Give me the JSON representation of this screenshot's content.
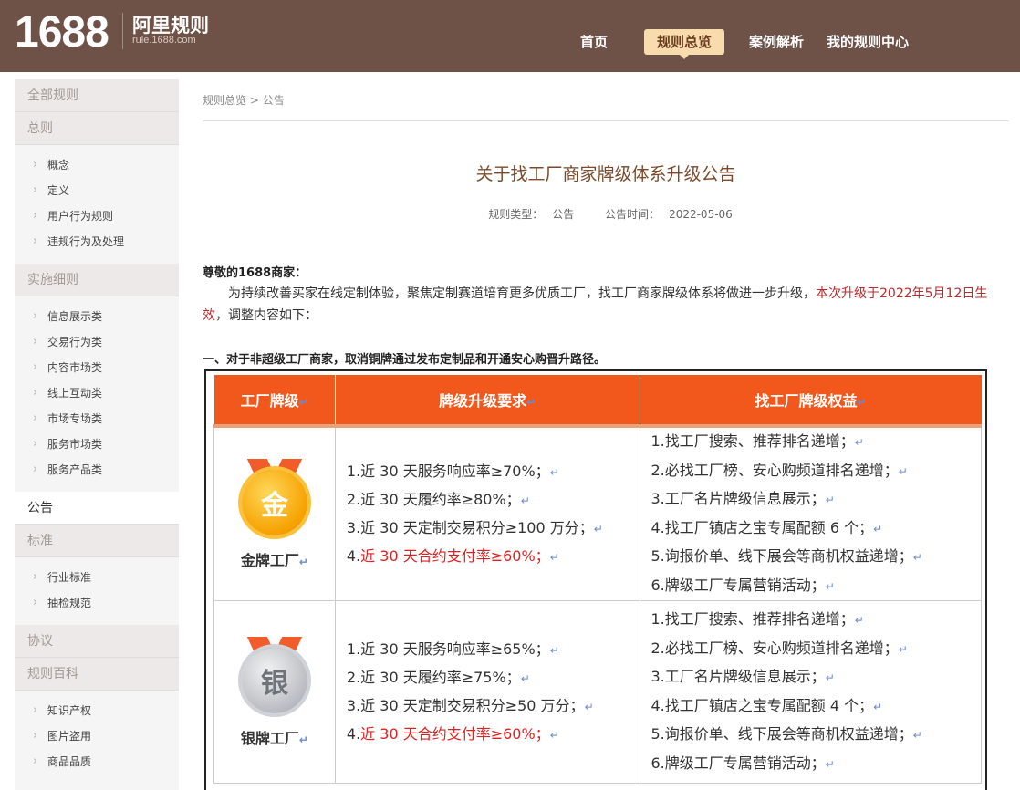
{
  "header": {
    "logo_number": "1688",
    "logo_text": "阿里规则",
    "logo_url": "rule.1688.com",
    "nav": [
      {
        "label": "首页",
        "active": false
      },
      {
        "label": "规则总览",
        "active": true
      },
      {
        "label": "案例解析",
        "active": false
      },
      {
        "label": "我的规则中心",
        "active": false
      }
    ]
  },
  "sidebar": {
    "all": "全部规则",
    "general": {
      "title": "总则",
      "items": [
        "概念",
        "定义",
        "用户行为规则",
        "违规行为及处理"
      ]
    },
    "detail": {
      "title": "实施细则",
      "items": [
        "信息展示类",
        "交易行为类",
        "内容市场类",
        "线上互动类",
        "市场专场类",
        "服务市场类",
        "服务产品类"
      ]
    },
    "notice": "公告",
    "standard": {
      "title": "标准",
      "items": [
        "行业标准",
        "抽检规范"
      ]
    },
    "agreement": "协议",
    "wiki": {
      "title": "规则百科",
      "items": [
        "知识产权",
        "图片盗用",
        "商品品质"
      ]
    }
  },
  "breadcrumb": {
    "root": "规则总览",
    "sep": ">",
    "current": "公告"
  },
  "article": {
    "title": "关于找工厂商家牌级体系升级公告",
    "type_label": "规则类型：",
    "type_value": "公告",
    "time_label": "公告时间：",
    "time_value": "2022-05-06",
    "greeting": "尊敬的1688商家：",
    "para_main": "为持续改善买家在线定制体验，聚焦定制赛道培育更多优质工厂，找工厂商家牌级体系将做进一步升级，",
    "para_red": "本次升级于2022年5月12日生效",
    "para_tail": "，调整内容如下：",
    "section1": "一、对于非超级工厂商家，取消铜牌通过发布定制品和开通安心购晋升路径。"
  },
  "table": {
    "headers": [
      "工厂牌级",
      "牌级升级要求",
      "找工厂牌级权益"
    ],
    "mark": "↵",
    "rows": [
      {
        "badge_char": "金",
        "badge_label": "金牌工厂",
        "req": [
          "1.近 30 天服务响应率≥70%；",
          "2.近 30 天履约率≥80%；",
          "3.近 30 天定制交易积分≥100 万分；"
        ],
        "req_red_num": "4.",
        "req_red": "近 30 天合约支付率≥60%；",
        "benefits": [
          "1.找工厂搜索、推荐排名递增；",
          "2.必找工厂榜、安心购频道排名递增；",
          "3.工厂名片牌级信息展示；",
          "4.找工厂镇店之宝专属配额 6 个；",
          "5.询报价单、线下展会等商机权益递增；",
          "6.牌级工厂专属营销活动；"
        ]
      },
      {
        "badge_char": "银",
        "badge_label": "银牌工厂",
        "req": [
          "1.近 30 天服务响应率≥65%；",
          "2.近 30 天履约率≥75%；",
          "3.近 30 天定制交易积分≥50 万分；"
        ],
        "req_red_num": "4.",
        "req_red": "近 30 天合约支付率≥60%；",
        "benefits": [
          "1.找工厂搜索、推荐排名递增；",
          "2.必找工厂榜、安心购频道排名递增；",
          "3.工厂名片牌级信息展示；",
          "4.找工厂镇店之宝专属配额 4 个；",
          "5.询报价单、线下展会等商机权益递增；",
          "6.牌级工厂专属营销活动；"
        ]
      }
    ]
  },
  "colors": {
    "header_bg": "#6e5147",
    "nav_active_bg": "#f8dcae",
    "table_header_bg": "#f2581c",
    "highlight_red": "#c0282a"
  }
}
